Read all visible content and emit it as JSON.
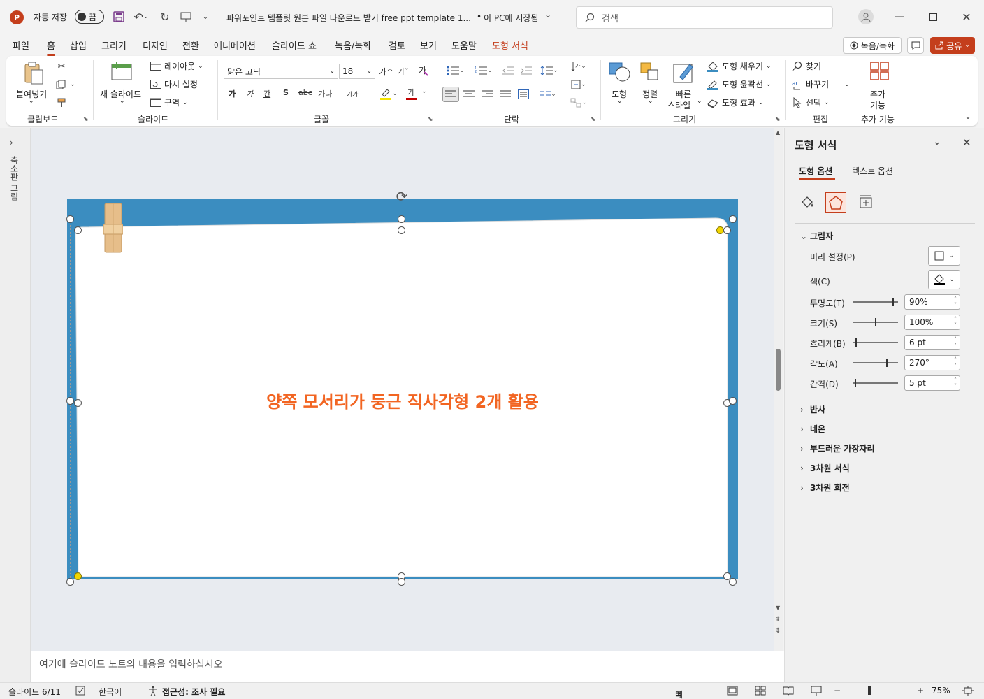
{
  "titlebar": {
    "autosave_label": "자동 저장",
    "autosave_state": "끔",
    "doc_title": "파워포인트 템플릿 원본 파일 다운로드 받기 free ppt template 1...",
    "save_location": "이 PC에 저장됨",
    "search_placeholder": "검색"
  },
  "tabs": [
    "파일",
    "홈",
    "삽입",
    "그리기",
    "디자인",
    "전환",
    "애니메이션",
    "슬라이드 쇼",
    "녹음/녹화",
    "검토",
    "보기",
    "도움말",
    "도형 서식"
  ],
  "tab_right": {
    "record": "녹음/녹화",
    "share": "공유"
  },
  "ribbon": {
    "clipboard": {
      "paste": "붙여넣기",
      "label": "클립보드"
    },
    "slides": {
      "new_slide": "새 슬라이드",
      "layout": "레이아웃",
      "reset": "다시 설정",
      "section": "구역",
      "label": "슬라이드"
    },
    "font": {
      "name": "맑은 고딕",
      "size": "18",
      "label": "글꼴",
      "grow": "가^",
      "shrink": "가ˇ",
      "bold": "가",
      "italic": "가",
      "underline": "간",
      "strike": "S",
      "spacing": "가나",
      "case": "가가",
      "color": "가"
    },
    "paragraph": {
      "label": "단락"
    },
    "drawing": {
      "shapes": "도형",
      "arrange": "정렬",
      "quick_styles_1": "빠른",
      "quick_styles_2": "스타일",
      "fill": "도형 채우기",
      "outline": "도형 윤곽선",
      "effects": "도형 효과",
      "label": "그리기"
    },
    "editing": {
      "find": "찾기",
      "replace": "바꾸기",
      "select": "선택",
      "label": "편집"
    },
    "addins": {
      "btn_1": "추가",
      "btn_2": "기능",
      "label": "추가 기능"
    }
  },
  "leftpane": {
    "label": "축소판 그림"
  },
  "slide": {
    "title": "양쪽 모서리가 둥근 직사각형 2개 활용"
  },
  "notes_placeholder": "여기에 슬라이드 노트의 내용을 입력하십시오",
  "format_pane": {
    "title": "도형 서식",
    "tab_shape": "도형 옵션",
    "tab_text": "텍스트 옵션",
    "shadow_section": "그림자",
    "preset_label": "미리 설정(P)",
    "color_label": "색(C)",
    "rows": [
      {
        "label": "투명도(T)",
        "value": "90%",
        "level": 0.9
      },
      {
        "label": "크기(S)",
        "value": "100%",
        "level": 0.5
      },
      {
        "label": "흐리게(B)",
        "value": "6 pt",
        "level": 0.05
      },
      {
        "label": "각도(A)",
        "value": "270°",
        "level": 0.75
      },
      {
        "label": "간격(D)",
        "value": "5 pt",
        "level": 0.03
      }
    ],
    "collapsed_sections": [
      "반사",
      "네온",
      "부드러운 가장자리",
      "3차원 서식",
      "3차원 회전"
    ]
  },
  "status": {
    "slide_index": "슬라이드 6/11",
    "language": "한국어",
    "accessibility": "접근성: 조사 필요",
    "notes": "메모",
    "zoom": "75%"
  },
  "colors": {
    "accent": "#c43e1c",
    "slide_frame": "#3b8dc0",
    "title_text": "#f26522"
  }
}
